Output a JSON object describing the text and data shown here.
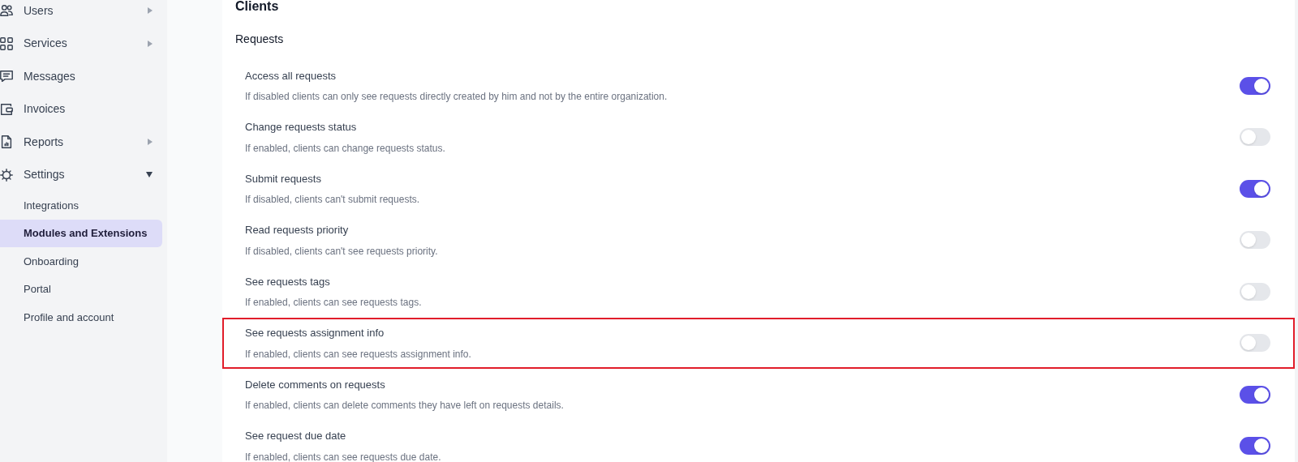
{
  "sidebar": {
    "items": [
      {
        "label": "Users",
        "kind": "group",
        "expanded": false,
        "selected": false
      },
      {
        "label": "Services",
        "kind": "group",
        "expanded": false,
        "selected": false
      },
      {
        "label": "Messages",
        "kind": "link",
        "selected": false
      },
      {
        "label": "Invoices",
        "kind": "link",
        "selected": false
      },
      {
        "label": "Reports",
        "kind": "group",
        "expanded": false,
        "selected": false
      },
      {
        "label": "Settings",
        "kind": "group",
        "expanded": true,
        "selected": false,
        "children": [
          {
            "label": "Integrations",
            "selected": false
          },
          {
            "label": "Modules and Extensions",
            "selected": true
          },
          {
            "label": "Onboarding",
            "selected": false
          },
          {
            "label": "Portal",
            "selected": false
          },
          {
            "label": "Profile and account",
            "selected": false
          }
        ]
      }
    ]
  },
  "main": {
    "title": "Clients",
    "section": "Requests",
    "settings": [
      {
        "title": "Access all requests",
        "description": "If disabled clients can only see requests directly created by him and not by the entire organization.",
        "on": true,
        "highlighted": false
      },
      {
        "title": "Change requests status",
        "description": "If enabled, clients can change requests status.",
        "on": false,
        "highlighted": false
      },
      {
        "title": "Submit requests",
        "description": "If disabled, clients can't submit requests.",
        "on": true,
        "highlighted": false
      },
      {
        "title": "Read requests priority",
        "description": "If disabled, clients can't see requests priority.",
        "on": false,
        "highlighted": false
      },
      {
        "title": "See requests tags",
        "description": "If enabled, clients can see requests tags.",
        "on": false,
        "highlighted": false
      },
      {
        "title": "See requests assignment info",
        "description": "If enabled, clients can see requests assignment info.",
        "on": false,
        "highlighted": true
      },
      {
        "title": "Delete comments on requests",
        "description": "If enabled, clients can delete comments they have left on requests details.",
        "on": true,
        "highlighted": false
      },
      {
        "title": "See request due date",
        "description": "If enabled, clients can see requests due date.",
        "on": true,
        "highlighted": false
      }
    ]
  }
}
